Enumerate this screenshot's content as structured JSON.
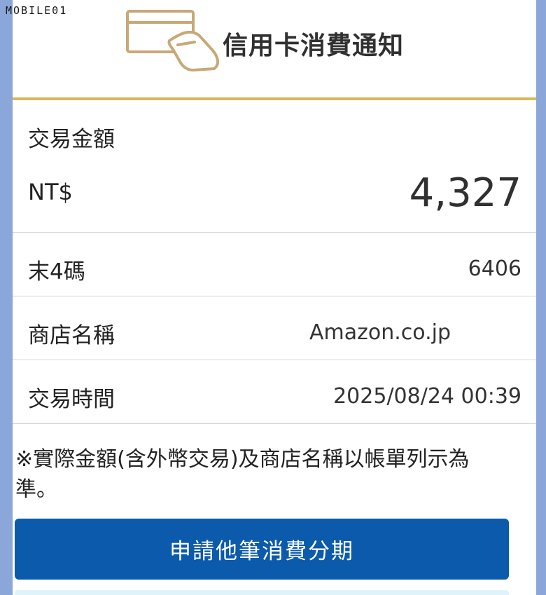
{
  "watermark": "MOBILE01",
  "header": {
    "title": "信用卡消費通知",
    "icon": "card-payment-icon"
  },
  "amount": {
    "label": "交易金額",
    "currency": "NT$",
    "value": "4,327"
  },
  "rows": [
    {
      "label": "末4碼",
      "value": "6406"
    },
    {
      "label": "商店名稱",
      "value": "Amazon.co.jp"
    },
    {
      "label": "交易時間",
      "value": "2025/08/24 00:39"
    }
  ],
  "note": "※實際金額(含外幣交易)及商店名稱以帳單列示為準。",
  "action": {
    "label": "申請他筆消費分期"
  },
  "colors": {
    "accent": "#d8b85b",
    "primary": "#0b5aab",
    "background": "#8ba6d8"
  }
}
